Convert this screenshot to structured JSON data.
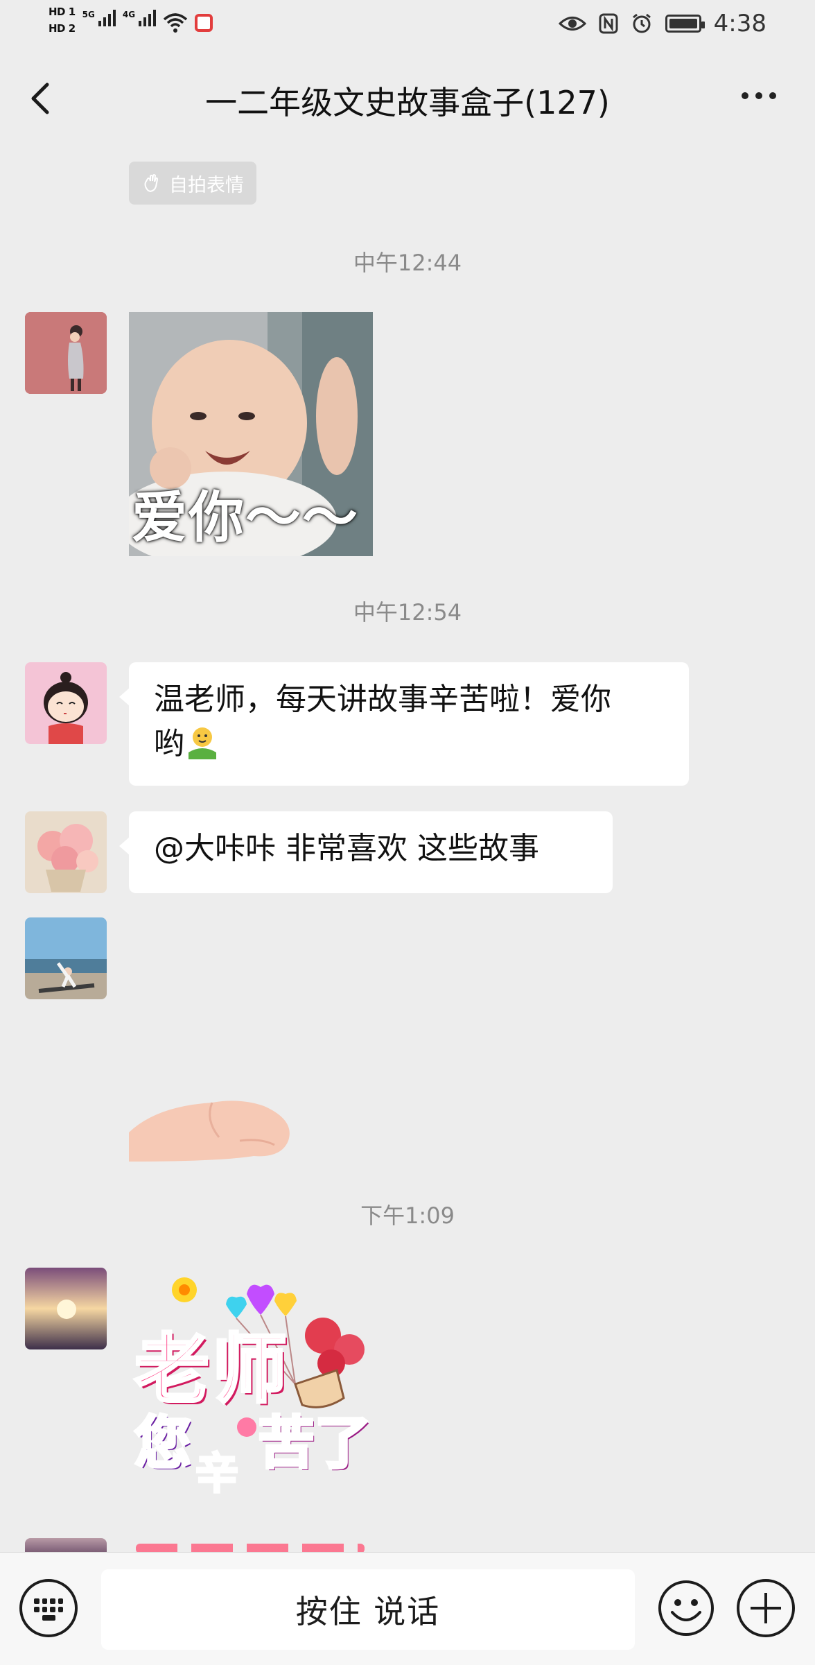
{
  "status_bar": {
    "hd1": "HD 1",
    "hd2": "HD 2",
    "net1": "5G",
    "net2": "4G",
    "time": "4:38",
    "icons": [
      "signal-icon",
      "wifi-icon",
      "app-notification-icon",
      "eye-icon",
      "nfc-icon",
      "alarm-icon",
      "battery-icon"
    ]
  },
  "header": {
    "title": "一二年级文史故事盒子(127)",
    "back_icon": "chevron-left-icon",
    "more_icon": "more-icon"
  },
  "chip": {
    "label": "自拍表情",
    "icon": "hand-wave-icon"
  },
  "messages": {
    "ts1": "中午12:44",
    "sticker1_caption": "爱你～～",
    "ts2": "中午12:54",
    "msg1": "温老师，每天讲故事辛苦啦！爱你",
    "msg1_line2": "哟",
    "msg2": "@大咔咔  非常喜欢 这些故事",
    "ts3": "下午1:09",
    "sticker3_line1": "老师",
    "sticker3_line2a": "您",
    "sticker3_line2b": "苦了",
    "sticker3_xin": "辛"
  },
  "bottom_bar": {
    "talk_label": "按住 说话",
    "keyboard_icon": "keyboard-icon",
    "emoji_icon": "emoji-icon",
    "plus_icon": "plus-icon"
  },
  "colors": {
    "background": "#ededed",
    "bubble": "#ffffff",
    "timestamp": "#8a8a8a",
    "chip": "#d9d9d9"
  }
}
